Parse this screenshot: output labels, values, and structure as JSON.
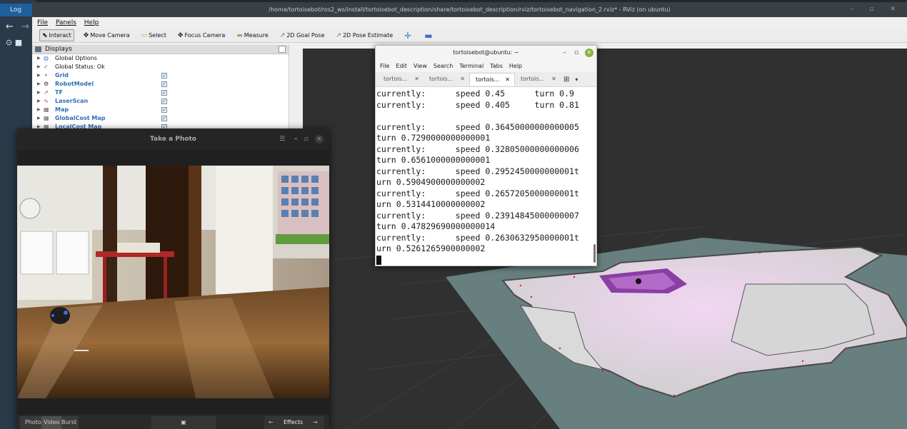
{
  "background": {
    "tab_label": "Log",
    "back_icon": "arrow-left-icon",
    "forward_icon": "arrow-right-icon"
  },
  "rviz": {
    "title": "/home/tortoisebot/ros2_ws/install/tortoisebot_description/share/tortoisebot_description/rviz/tortoisebot_navigation_2.rviz* - RViz (on ubuntu)",
    "menu": {
      "file": "File",
      "panels": "Panels",
      "help": "Help"
    },
    "toolbar": {
      "interact": "Interact",
      "move_camera": "Move Camera",
      "select": "Select",
      "focus_camera": "Focus Camera",
      "measure": "Measure",
      "goal_pose": "2D Goal Pose",
      "pose_estimate": "2D Pose Estimate"
    },
    "displays": {
      "title": "Displays",
      "items": [
        {
          "label": "Global Options",
          "icon": "globe-icon",
          "checked": false
        },
        {
          "label": "Global Status: Ok",
          "icon": "check-icon",
          "checked": false
        },
        {
          "label": "Grid",
          "icon": "grid-icon",
          "checked": true
        },
        {
          "label": "RobotModel",
          "icon": "robot-icon",
          "checked": true
        },
        {
          "label": "TF",
          "icon": "tf-icon",
          "checked": true
        },
        {
          "label": "LaserScan",
          "icon": "laser-icon",
          "checked": true
        },
        {
          "label": "Map",
          "icon": "map-icon",
          "checked": true
        },
        {
          "label": "GlobalCost Map",
          "icon": "map-icon",
          "checked": true
        },
        {
          "label": "LocalCost Map",
          "icon": "map-icon",
          "checked": true
        }
      ]
    }
  },
  "terminal": {
    "title": "tortoisebot@ubuntu: ~",
    "menu": [
      "File",
      "Edit",
      "View",
      "Search",
      "Terminal",
      "Tabs",
      "Help"
    ],
    "tabs": [
      "tortois...",
      "tortois...",
      "tortois...",
      "tortois..."
    ],
    "active_tab": 2,
    "lines": [
      "currently:      speed 0.45      turn 0.9",
      "currently:      speed 0.405     turn 0.81",
      "",
      "currently:      speed 0.36450000000000005",
      "turn 0.7290000000000001",
      "currently:      speed 0.32805000000000006",
      "turn 0.6561000000000001",
      "currently:      speed 0.2952450000000001t",
      "urn 0.5904900000000002",
      "currently:      speed 0.2657205000000001t",
      "urn 0.5314410000000002",
      "currently:      speed 0.23914845000000007",
      "turn 0.47829690000000014",
      "currently:      speed 0.2630632950000001t",
      "urn 0.5261265900000002"
    ]
  },
  "camera": {
    "title": "Take a Photo",
    "modes": {
      "photo": "Photo",
      "video": "Video",
      "burst": "Burst"
    },
    "effects": "Effects",
    "capture_icon": "camera-icon"
  }
}
